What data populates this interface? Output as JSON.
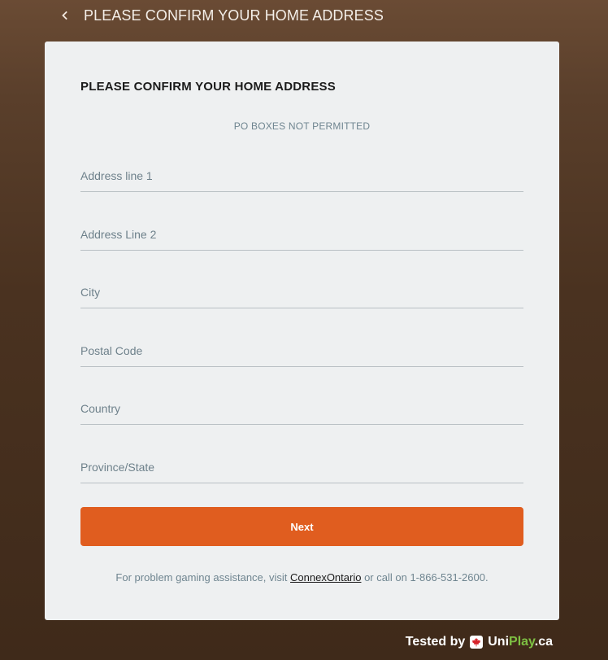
{
  "header": {
    "title": "PLEASE CONFIRM YOUR HOME ADDRESS"
  },
  "card": {
    "title": "PLEASE CONFIRM YOUR HOME ADDRESS",
    "notice": "PO BOXES NOT PERMITTED",
    "fields": {
      "address1": {
        "placeholder": "Address line 1",
        "value": ""
      },
      "address2": {
        "placeholder": "Address Line 2",
        "value": ""
      },
      "city": {
        "placeholder": "City",
        "value": ""
      },
      "postal": {
        "placeholder": "Postal Code",
        "value": ""
      },
      "country": {
        "placeholder": "Country",
        "value": ""
      },
      "province": {
        "placeholder": "Province/State",
        "value": ""
      }
    },
    "next_label": "Next",
    "footer": {
      "prefix": "For problem gaming assistance, visit ",
      "link_text": "ConnexOntario",
      "suffix": " or call on 1-866-531-2600."
    }
  },
  "badge": {
    "tested_by": "Tested by",
    "brand_uni": "Uni",
    "brand_play": "Play",
    "brand_ca": ".ca"
  },
  "icons": {
    "back": "chevron-left-icon",
    "maple": "maple-leaf-icon"
  },
  "colors": {
    "accent": "#e05d1f",
    "card_bg": "#eef0f1",
    "brand_green": "#7ec043"
  }
}
